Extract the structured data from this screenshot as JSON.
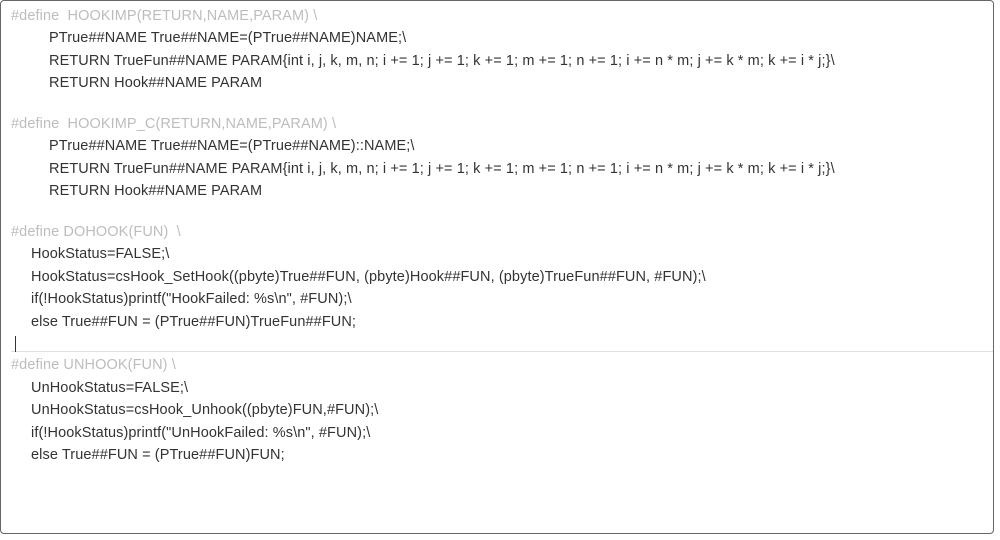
{
  "blocks": {
    "hookimp": [
      "#define  HOOKIMP(RETURN,NAME,PARAM) \\",
      "PTrue##NAME True##NAME=(PTrue##NAME)NAME;\\",
      "RETURN TrueFun##NAME PARAM{int i, j, k, m, n; i += 1; j += 1; k += 1; m += 1; n += 1; i += n * m; j += k * m; k += i * j;}\\",
      "RETURN Hook##NAME PARAM"
    ],
    "hookimp_c": [
      "#define  HOOKIMP_C(RETURN,NAME,PARAM) \\",
      "PTrue##NAME True##NAME=(PTrue##NAME)::NAME;\\",
      "RETURN TrueFun##NAME PARAM{int i, j, k, m, n; i += 1; j += 1; k += 1; m += 1; n += 1; i += n * m; j += k * m; k += i * j;}\\",
      "RETURN Hook##NAME PARAM"
    ],
    "dohook": [
      "#define DOHOOK(FUN)  \\",
      "HookStatus=FALSE;\\",
      "HookStatus=csHook_SetHook((pbyte)True##FUN, (pbyte)Hook##FUN, (pbyte)TrueFun##FUN, #FUN);\\",
      "if(!HookStatus)printf(\"HookFailed: %s\\n\", #FUN);\\",
      "else True##FUN = (PTrue##FUN)TrueFun##FUN;"
    ],
    "unhook": [
      "#define UNHOOK(FUN) \\",
      "UnHookStatus=FALSE;\\",
      "UnHookStatus=csHook_Unhook((pbyte)FUN,#FUN);\\",
      "if(!HookStatus)printf(\"UnHookFailed: %s\\n\", #FUN);\\",
      "else True##FUN = (PTrue##FUN)FUN;"
    ]
  }
}
